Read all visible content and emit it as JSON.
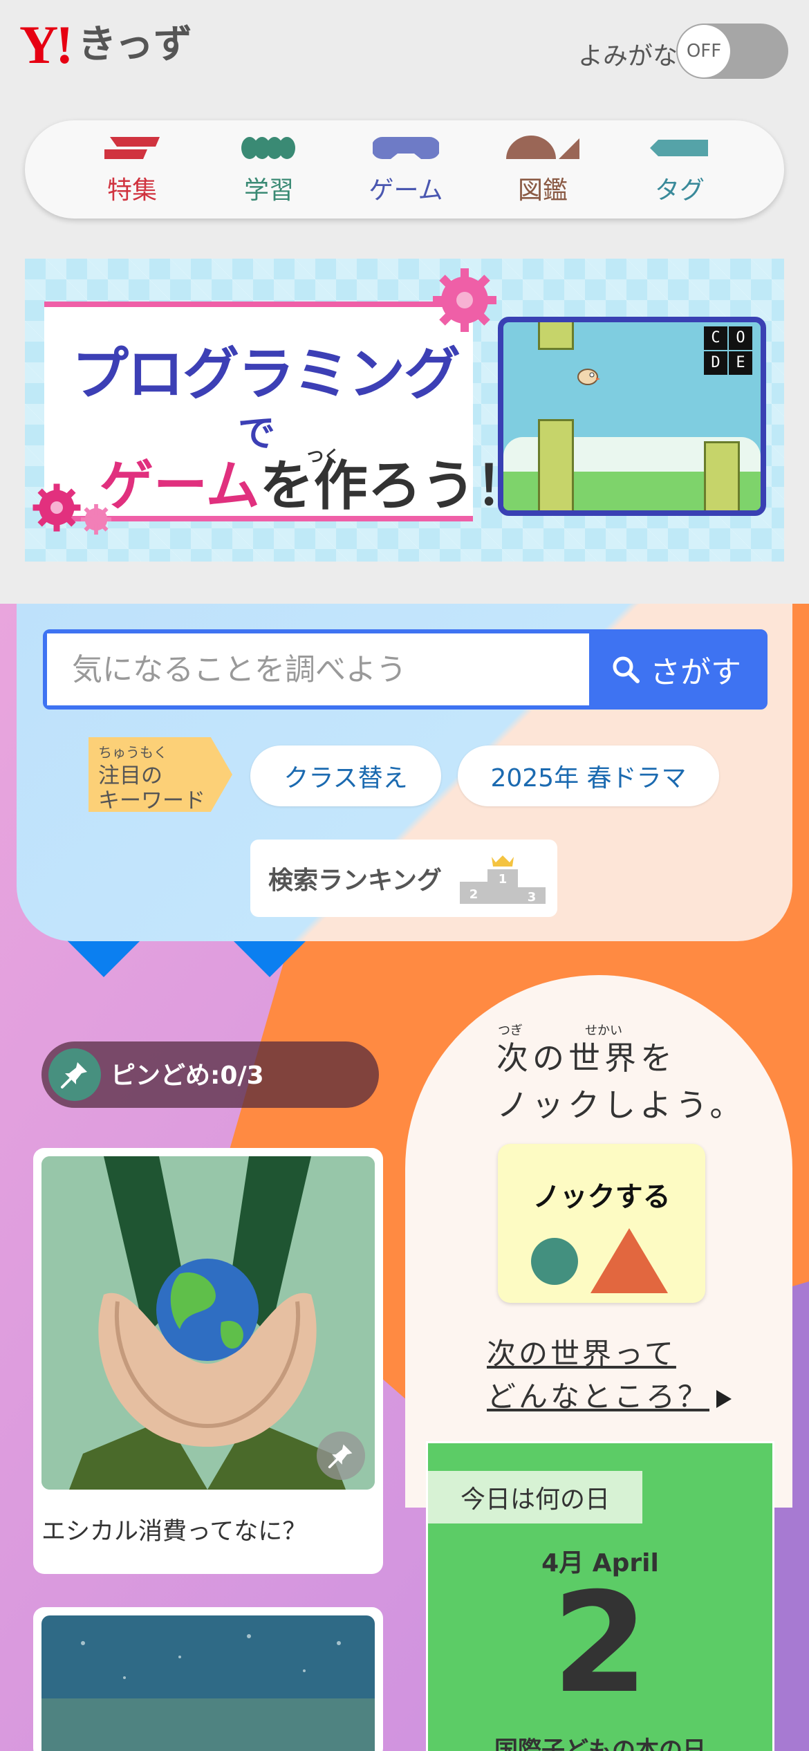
{
  "header": {
    "logo_y": "Y!",
    "logo_text": "きっず",
    "yomigana_label": "よみがな",
    "toggle_state": "OFF"
  },
  "nav": {
    "items": [
      {
        "label": "特集",
        "color": "#d0333f",
        "icon": "feature-icon"
      },
      {
        "label": "学習",
        "color": "#3a8a74",
        "icon": "study-icon"
      },
      {
        "label": "ゲーム",
        "color": "#4a57b0",
        "icon": "game-icon"
      },
      {
        "label": "図鑑",
        "color": "#8a5a44",
        "icon": "encyclopedia-icon"
      },
      {
        "label": "タグ",
        "color": "#3a8a9a",
        "icon": "tag-icon"
      }
    ]
  },
  "banner": {
    "line1": "プログラミング",
    "line2": "で",
    "line3a": "ゲーム",
    "line3b": "を作ろう！",
    "ruby": "つく",
    "code_letters": [
      "C",
      "O",
      "D",
      "E"
    ]
  },
  "search": {
    "placeholder": "気になることを調べよう",
    "button_label": "さがす",
    "keyword_ruby": "ちゅうもく",
    "keyword_label_1": "注目の",
    "keyword_label_2": "キーワード",
    "keywords": [
      "クラス替え",
      "2025年 春ドラマ"
    ],
    "ranking_label": "検索ランキング",
    "podium": [
      "2",
      "1",
      "3"
    ]
  },
  "pins": {
    "label": "ピンどめ:0/3"
  },
  "cards": [
    {
      "title": "エシカル消費ってなに？"
    }
  ],
  "knock": {
    "ruby_1": "つぎ",
    "ruby_2": "せかい",
    "line1": "次の世界を",
    "line2": "ノックしよう。",
    "button_label": "ノックする",
    "link_line1": "次の世界って",
    "link_line2": "どんなところ？",
    "circle_color": "#43907f",
    "triangle_color": "#e2673f"
  },
  "today": {
    "label": "今日は何の日",
    "month": "4月 April",
    "day": "2",
    "event": "国際子どもの本の日"
  }
}
